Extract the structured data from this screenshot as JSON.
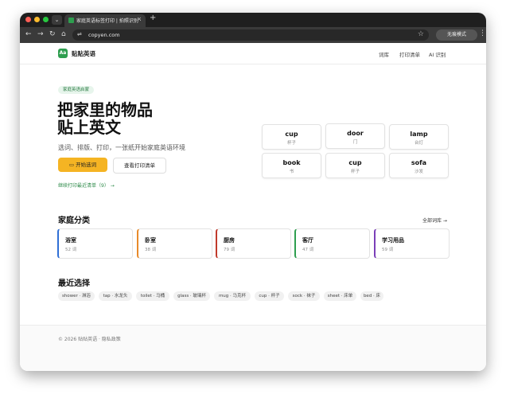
{
  "browser": {
    "tab_title": "家庭英语标签打印 | 拍照识别 ·",
    "tab_close": "×",
    "tabs_dropdown": "⌄",
    "new_tab": "+",
    "url": "copyen.com",
    "incognito_label": "无痕模式",
    "back_icon": "←",
    "forward_icon": "→",
    "reload_icon": "↻",
    "home_icon": "⌂",
    "star_icon": "☆",
    "menu_icon": "⋮",
    "site_info_icon": "⇌",
    "traffic_colors": [
      "#ff5f57",
      "#febc2e",
      "#28c840"
    ]
  },
  "site": {
    "logo_text": "Aa",
    "brand": "贴贴英语",
    "nav": [
      "词库",
      "打印清单",
      "AI 识别"
    ]
  },
  "hero": {
    "badge": "家庭英语启蒙",
    "title_line1": "把家里的物品",
    "title_line2": "贴上英文",
    "subtitle": "选词、排版、打印，一张纸开始家庭英语环境",
    "primary_button": "开始选词",
    "secondary_button": "查看打印清单",
    "continue_link": "继续打印最近清单（9） →"
  },
  "word_cards": [
    {
      "en": "cup",
      "zh": "杯子"
    },
    {
      "en": "door",
      "zh": "门"
    },
    {
      "en": "lamp",
      "zh": "台灯"
    },
    {
      "en": "book",
      "zh": "书"
    },
    {
      "en": "cup",
      "zh": "杯子"
    },
    {
      "en": "sofa",
      "zh": "沙发"
    }
  ],
  "categories_section": {
    "title": "家庭分类",
    "all_link": "全部词库 →",
    "items": [
      {
        "name": "浴室",
        "count": "52 词",
        "color": "#2f6fd6"
      },
      {
        "name": "卧室",
        "count": "38 词",
        "color": "#e88a2a"
      },
      {
        "name": "厨房",
        "count": "79 词",
        "color": "#c0392b"
      },
      {
        "name": "客厅",
        "count": "47 词",
        "color": "#2e9e4f"
      },
      {
        "name": "学习用品",
        "count": "59 词",
        "color": "#7b3fb8"
      }
    ]
  },
  "recent_section": {
    "title": "最近选择",
    "chips": [
      "shower · 淋浴",
      "tap · 水龙头",
      "toilet · 马桶",
      "glass · 玻璃杯",
      "mug · 马克杯",
      "cup · 杯子",
      "sock · 袜子",
      "sheet · 床单",
      "bed · 床"
    ]
  },
  "footer": {
    "text": "© 2026 贴贴英语 · 隐私政策"
  }
}
